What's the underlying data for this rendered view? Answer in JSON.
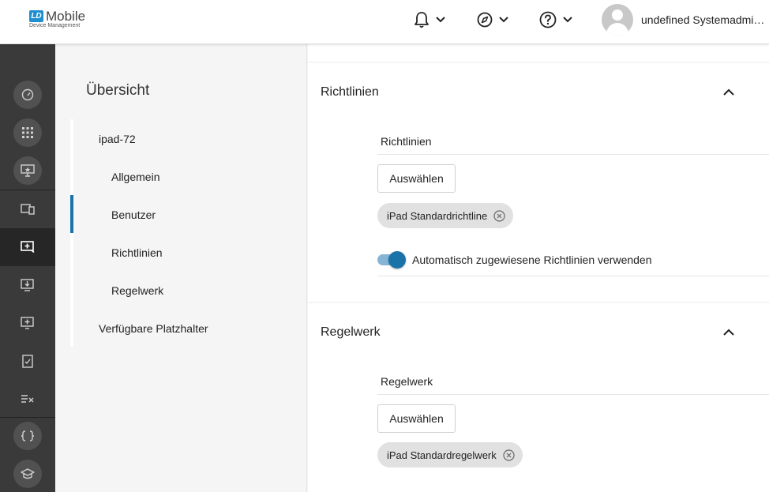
{
  "header": {
    "logo_badge": "LD",
    "logo_title": "Mobile",
    "logo_subtitle": "Device Management",
    "user_name": "undefined Systemadmi…",
    "icons": [
      "bell-icon",
      "compass-icon",
      "help-icon"
    ]
  },
  "overview": {
    "title": "Übersicht",
    "items": [
      {
        "label": "ipad-72",
        "level": 1
      },
      {
        "label": "Allgemein",
        "level": 2
      },
      {
        "label": "Benutzer",
        "level": 2,
        "active": true
      },
      {
        "label": "Richtlinien",
        "level": 2
      },
      {
        "label": "Regelwerk",
        "level": 2
      },
      {
        "label": "Verfügbare Platzhalter",
        "level": 1
      }
    ]
  },
  "sections": {
    "richtlinien": {
      "title": "Richtlinien",
      "field_label": "Richtlinien",
      "select_label": "Auswählen",
      "chip": "iPad Standardrichtline",
      "toggle_label": "Automatisch zugewiesene Richtlinien verwenden",
      "toggle_on": true
    },
    "regelwerk": {
      "title": "Regelwerk",
      "field_label": "Regelwerk",
      "select_label": "Auswählen",
      "chip": "iPad Standardregelwerk"
    }
  },
  "colors": {
    "accent": "#1a73a8",
    "rail_bg": "#3a3a3a",
    "logo_blue": "#1f8fd1"
  }
}
